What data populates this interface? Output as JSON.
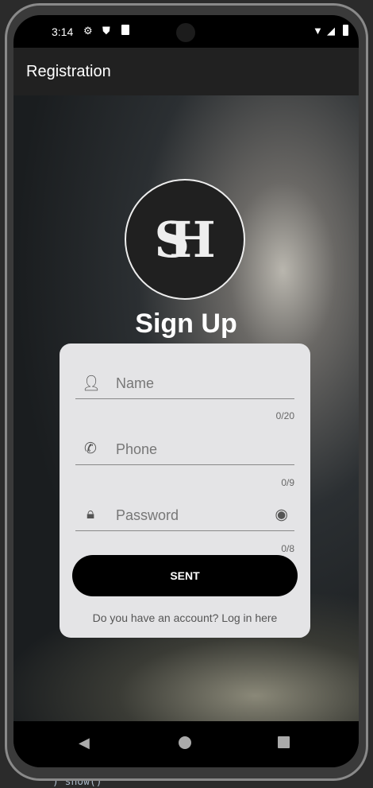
{
  "status_bar": {
    "time": "3:14",
    "left_icons": [
      "gear-icon",
      "shield-icon",
      "sd-card-icon"
    ],
    "right_icons": [
      "wifi-icon",
      "signal-icon",
      "battery-icon"
    ]
  },
  "app_bar": {
    "title": "Registration"
  },
  "logo": {
    "monogram": "SH"
  },
  "main": {
    "title": "Sign Up"
  },
  "form": {
    "name": {
      "placeholder": "Name",
      "counter": "0/20"
    },
    "phone": {
      "placeholder": "Phone",
      "counter": "0/9"
    },
    "password": {
      "placeholder": "Password",
      "counter": "0/8"
    },
    "submit_label": "SENT",
    "login_link": "Do you have an account? Log in here"
  },
  "ide_background": {
    "code": ") show()"
  }
}
